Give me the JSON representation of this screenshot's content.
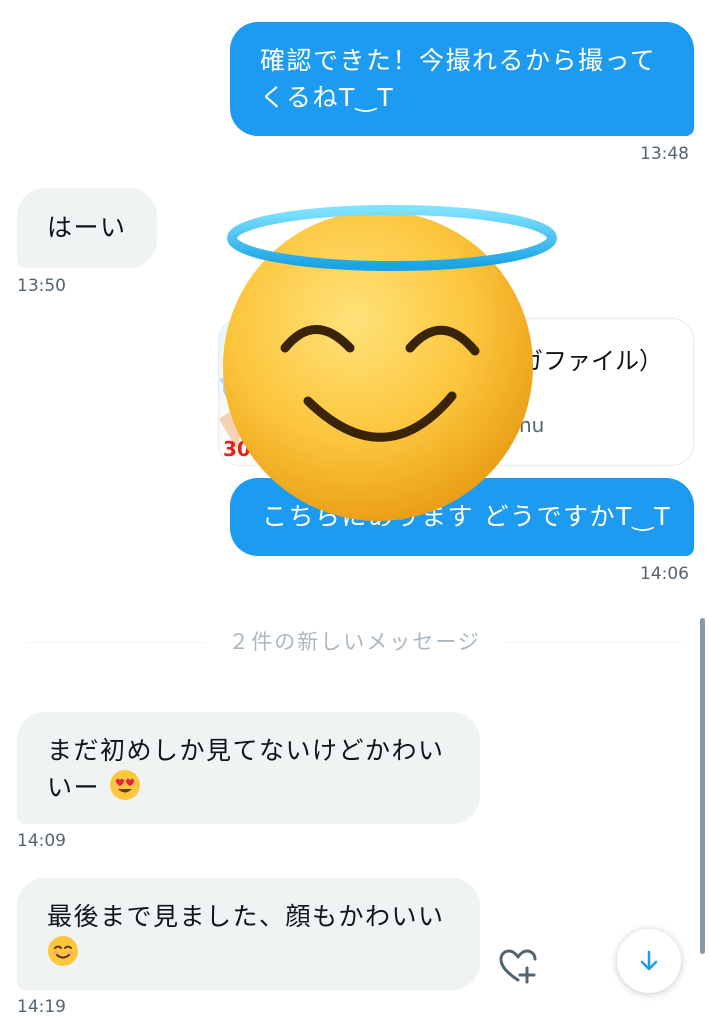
{
  "messages": [
    {
      "direction": "out",
      "lines": [
        "確認できた！今撮れるから撮って",
        "くるねT‿T"
      ],
      "time": "13:48"
    },
    {
      "direction": "in",
      "lines": [
        "はーい"
      ],
      "time": "13:50"
    },
    {
      "direction": "out",
      "lines": [
        "こちらにあります どうですかT‿T"
      ],
      "time": "14:06"
    },
    {
      "direction": "in",
      "lines": [
        "まだ初めしか見てないけどかわい",
        "いー"
      ],
      "time": "14:09",
      "emoji": "heart-eyes"
    },
    {
      "direction": "in",
      "lines": [
        "最後まで見ました、顔もかわいい"
      ],
      "time": "14:19",
      "emoji": "smiling"
    }
  ],
  "link_card": {
    "thumb_badge": "30",
    "title": "ガファイル）",
    "subtitle": "nu"
  },
  "new_messages_divider": "２件の新しいメッセージ",
  "overlay_sticker": "smiling-face-with-halo",
  "controls": {
    "add_reaction_icon": "heart-plus-icon",
    "scroll_down_icon": "arrow-down-icon"
  },
  "colors": {
    "outgoing_bubble": "#1d9bf0",
    "incoming_bubble": "#eff3f4",
    "timestamp": "#536471",
    "divider_text": "#aab8c2"
  }
}
